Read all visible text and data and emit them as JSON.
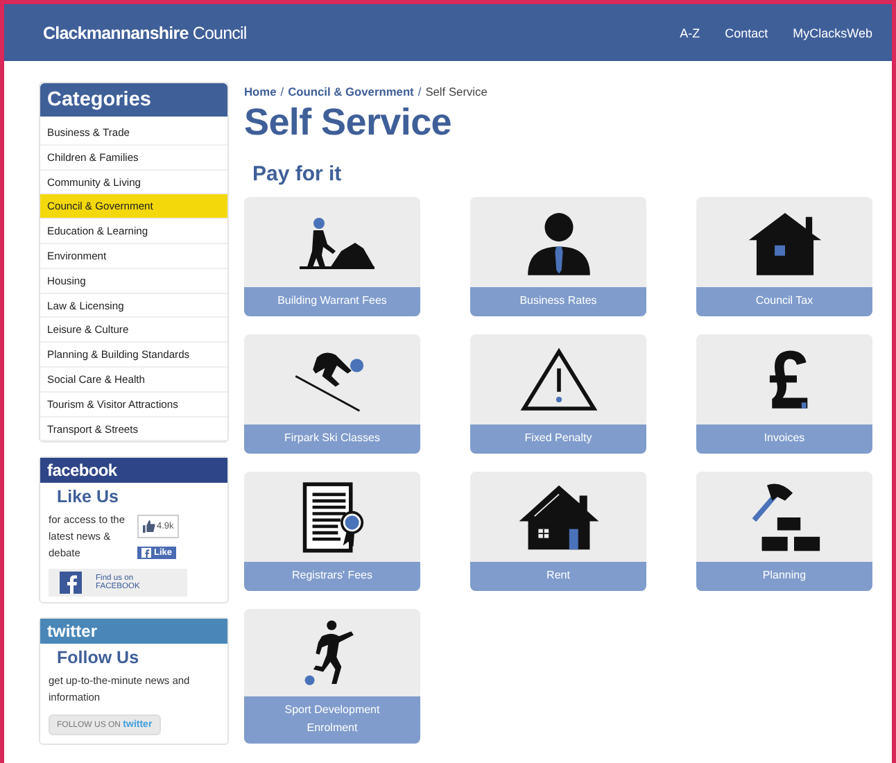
{
  "header": {
    "logo": "**Clackmannanshire** Council",
    "nav": [
      "A-Z",
      "Contact",
      "MyClacksWeb"
    ]
  },
  "sidebar": {
    "title": "Categories",
    "items": [
      {
        "label": "Business & Trade",
        "selected": false
      },
      {
        "label": "Children & Families",
        "selected": false
      },
      {
        "label": "Community & Living",
        "selected": false
      },
      {
        "label": "Council & Government",
        "selected": true
      },
      {
        "label": "Education & Learning",
        "selected": false
      },
      {
        "label": "Environment",
        "selected": false
      },
      {
        "label": "Housing",
        "selected": false
      },
      {
        "label": "Law & Licensing",
        "selected": false
      },
      {
        "label": "Leisure & Culture",
        "selected": false
      },
      {
        "label": "Planning & Building Standards",
        "selected": false
      },
      {
        "label": "Social Care & Health",
        "selected": false
      },
      {
        "label": "Tourism & Visitor Attractions",
        "selected": false
      },
      {
        "label": "Transport & Streets",
        "selected": false
      }
    ]
  },
  "facebook": {
    "logo": "facebook",
    "heading": "Like Us",
    "text": "for access to the latest news & debate",
    "like_count": "4.9k",
    "like_button": "Like",
    "find_button": "Find us on FACEBOOK"
  },
  "twitter": {
    "logo": "twitter",
    "heading": "Follow Us",
    "text": "get up-to-the-minute news and information",
    "follow_label": "FOLLOW US ON",
    "follow_brand": "twitter"
  },
  "breadcrumb": [
    "Home",
    "Council & Government",
    "Self Service"
  ],
  "breadcrumb_separator": "/",
  "title": "Self Service",
  "section": "Pay for it",
  "tiles": [
    {
      "label": "Building Warrant Fees",
      "kind": "worker"
    },
    {
      "label": "Business Rates",
      "kind": "person"
    },
    {
      "label": "Council Tax",
      "kind": "house"
    },
    {
      "label": "Firpark Ski Classes",
      "kind": "skier"
    },
    {
      "label": "Fixed Penalty",
      "kind": "warning"
    },
    {
      "label": "Invoices",
      "kind": "pound"
    },
    {
      "label": "Registrars' Fees",
      "kind": "certificate"
    },
    {
      "label": "Rent",
      "kind": "home"
    },
    {
      "label": "Planning",
      "kind": "hammer"
    },
    {
      "label": "Sport Development Enrolment",
      "kind": "footballer"
    }
  ]
}
